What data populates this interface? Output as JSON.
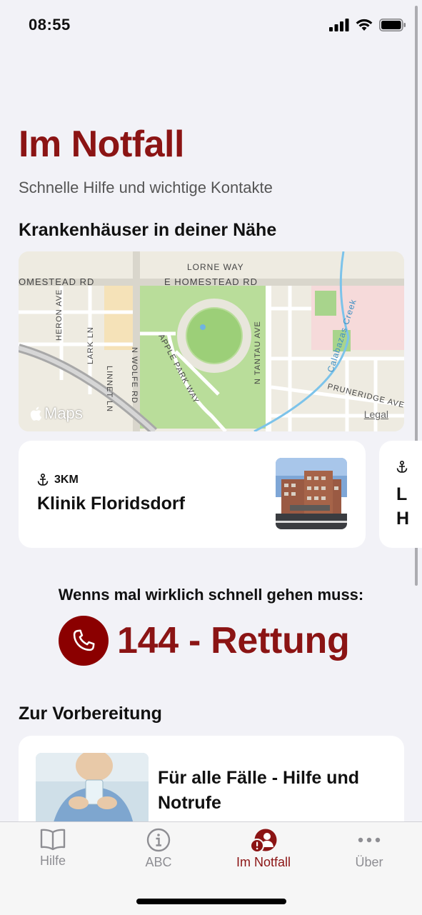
{
  "status": {
    "time": "08:55"
  },
  "header": {
    "title": "Im Notfall",
    "subtitle": "Schnelle Hilfe und wichtige Kontakte"
  },
  "hospitals": {
    "section_title": "Krankenhäuser in deiner Nähe",
    "map": {
      "logo": "Maps",
      "legal": "Legal",
      "streets": [
        "LORNE WAY",
        "E HOMESTEAD RD",
        "OMESTEAD RD",
        "HERON AVE",
        "LINNET LN",
        "LARK LN",
        "N WOLFE RD",
        "APPLE PARK WAY",
        "N TANTAU AVE",
        "PRUNERIDGE AVE",
        "Calabazas Creek"
      ]
    },
    "cards": [
      {
        "distance": "3KM",
        "name": "Klinik Floridsdorf"
      },
      {
        "partial_name": "L\nH"
      }
    ]
  },
  "emergency": {
    "prompt": "Wenns mal wirklich schnell gehen muss:",
    "call_label": "144 - Rettung"
  },
  "preparation": {
    "section_title": "Zur Vorbereitung",
    "card_title": "Für alle Fälle - Hilfe und Notrufe"
  },
  "tabs": [
    {
      "label": "Hilfe",
      "icon": "book-icon",
      "active": false
    },
    {
      "label": "ABC",
      "icon": "info-icon",
      "active": false
    },
    {
      "label": "Im Notfall",
      "icon": "emergency-person-icon",
      "active": true
    },
    {
      "label": "Über",
      "icon": "more-icon",
      "active": false
    }
  ],
  "colors": {
    "accent": "#8b1414",
    "background": "#f2f2f7",
    "card": "#ffffff",
    "tab_inactive": "#8e8e93"
  }
}
